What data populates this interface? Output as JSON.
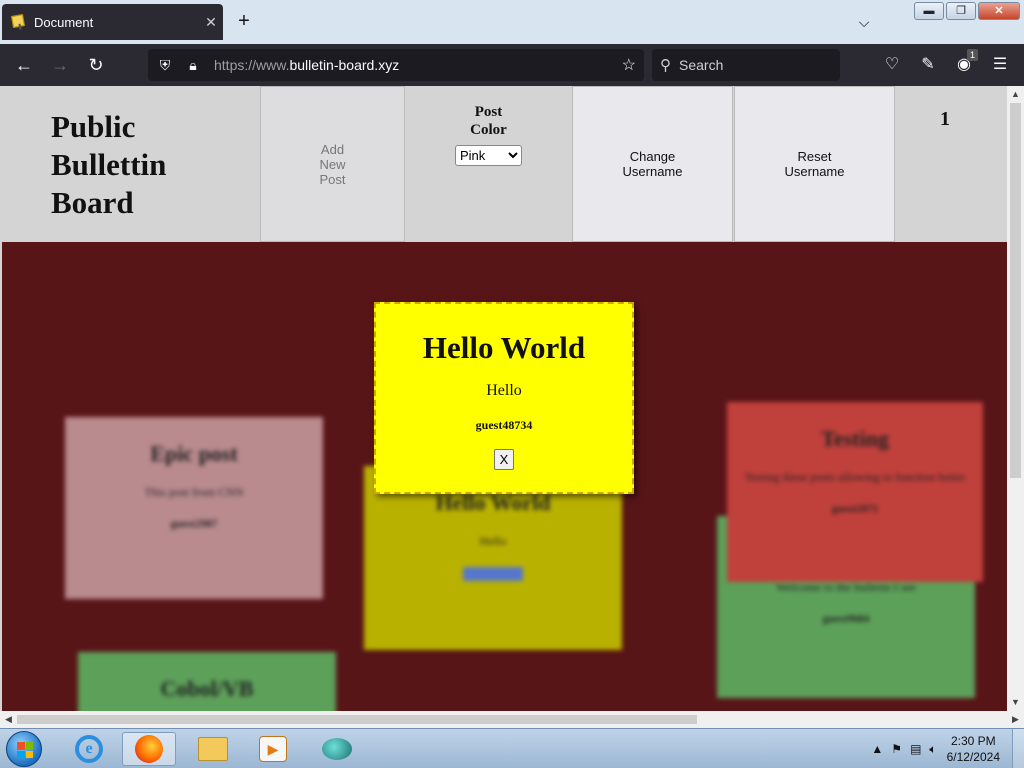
{
  "browser": {
    "tab_title": "Document",
    "tab_close": "✕",
    "new_tab": "+",
    "url_dim": "https://www.",
    "url_host": "bulletin-board.xyz",
    "search_placeholder": "Search",
    "extension_badge": "1"
  },
  "header": {
    "title": "Public Bullettin Board",
    "add_post_label": "Add\nNew\nPost",
    "post_color_label": "Post\nColor",
    "post_color_selected": "Pink",
    "change_username_label": "Change\nUsername",
    "reset_username_label": "Reset\nUsername",
    "post_count": "1"
  },
  "modal": {
    "title": "Hello World",
    "body": "Hello",
    "username": "guest48734",
    "close_label": "X"
  },
  "board_posts": [
    {
      "title": "Epic post",
      "body": "This post from CNN",
      "user": "guest2987",
      "color": "#b98a8e"
    },
    {
      "title": "Hello World",
      "body": "Hello",
      "user": "",
      "color": "#b9b100"
    },
    {
      "title": "Testing",
      "body": "Testing these posts allowing to function better",
      "user": "guest2071",
      "color": "#c0403c"
    },
    {
      "title": "",
      "body": "Welcome to the bulletin I see",
      "user": "guest9684",
      "color": "#5da05a"
    },
    {
      "title": "Cobol/VB",
      "body": "",
      "user": "",
      "color": "#5da05a"
    }
  ],
  "taskbar": {
    "clock_time": "2:30 PM",
    "clock_date": "6/12/2024"
  },
  "colors": {
    "board_bg": "#581518",
    "modal_bg": "#ffff00"
  }
}
